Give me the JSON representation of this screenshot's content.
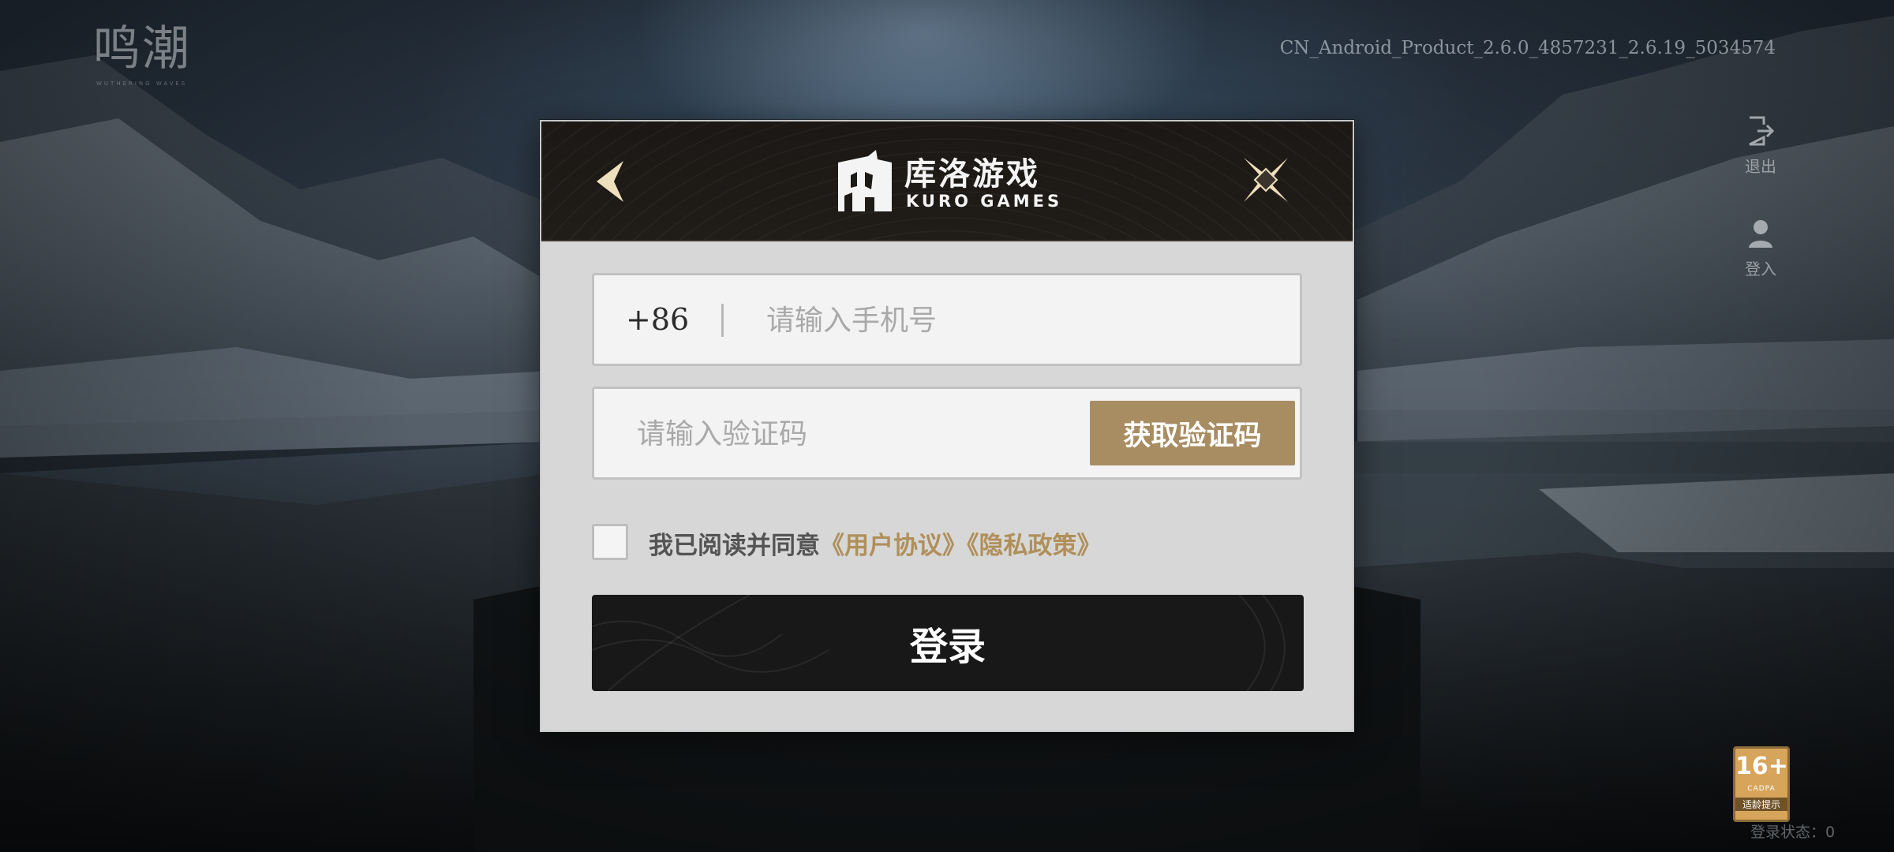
{
  "app": {
    "logo_text": "鸣潮",
    "logo_subtext": "WUTHERING WAVES",
    "version": "CN_Android_Product_2.6.0_4857231_2.6.19_5034574"
  },
  "side_menu": {
    "exit_label": "退出",
    "login_label": "登入"
  },
  "dialog": {
    "brand_cn": "库洛游戏",
    "brand_en": "KURO GAMES",
    "country_code": "+86",
    "phone_placeholder": "请输入手机号",
    "code_placeholder": "请输入验证码",
    "get_code_label": "获取验证码",
    "agree_prefix": "我已阅读并同意",
    "user_agreement": "《用户协议》",
    "privacy_policy": "《隐私政策》",
    "login_label": "登录"
  },
  "age_rating": {
    "age": "16+",
    "org": "CADPA",
    "tip": "适龄提示"
  },
  "status": {
    "text": "登录状态：0"
  },
  "colors": {
    "accent_gold": "#a88d63",
    "link_gold": "#b08f5a",
    "login_button": "#181818",
    "dialog_bg": "#d7d7d7"
  },
  "icons": [
    "back-arrow-icon",
    "close-star-icon",
    "exit-icon",
    "user-icon",
    "kuro-logo-icon",
    "checkbox-icon"
  ]
}
